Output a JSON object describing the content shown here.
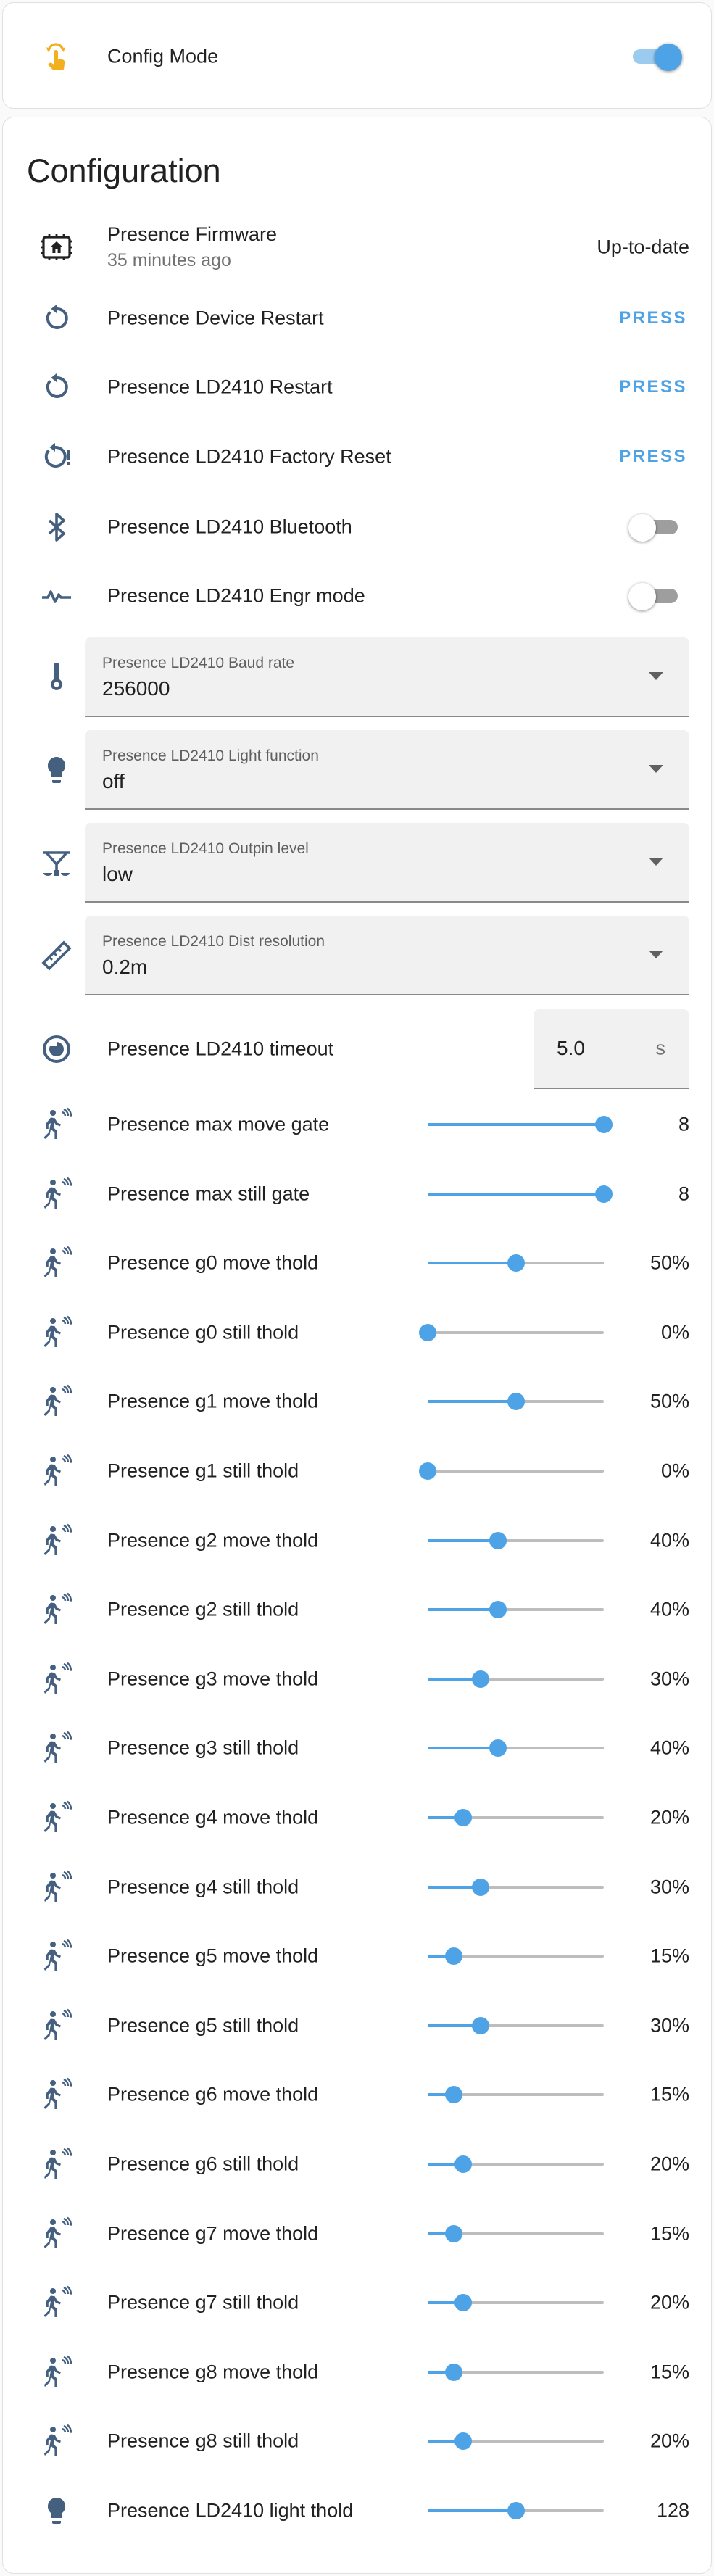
{
  "config_mode": {
    "label": "Config Mode",
    "on": true
  },
  "configuration": {
    "title": "Configuration",
    "firmware": {
      "label": "Presence Firmware",
      "time": "35 minutes ago",
      "status": "Up-to-date"
    },
    "buttons": [
      {
        "label": "Presence Device Restart",
        "action": "PRESS",
        "icon": "restart-icon"
      },
      {
        "label": "Presence LD2410 Restart",
        "action": "PRESS",
        "icon": "restart-icon"
      },
      {
        "label": "Presence LD2410 Factory Reset",
        "action": "PRESS",
        "icon": "factory-reset-icon"
      }
    ],
    "switches": [
      {
        "label": "Presence LD2410 Bluetooth",
        "on": false,
        "icon": "bluetooth-icon"
      },
      {
        "label": "Presence LD2410 Engr mode",
        "on": false,
        "icon": "pulse-icon"
      }
    ],
    "selects": [
      {
        "label": "Presence LD2410 Baud rate",
        "value": "256000",
        "icon": "thermometer-icon"
      },
      {
        "label": "Presence LD2410 Light function",
        "value": "off",
        "icon": "lightbulb-icon"
      },
      {
        "label": "Presence LD2410 Outpin level",
        "value": "low",
        "icon": "scale-icon"
      },
      {
        "label": "Presence LD2410 Dist resolution",
        "value": "0.2m",
        "icon": "ruler-icon"
      }
    ],
    "timeout": {
      "label": "Presence LD2410 timeout",
      "value": "5.0",
      "unit": "s"
    },
    "sliders": [
      {
        "label": "Presence max move gate",
        "value": "8",
        "fraction": 1.0,
        "icon": "motion-sensor-icon"
      },
      {
        "label": "Presence max still gate",
        "value": "8",
        "fraction": 1.0,
        "icon": "motion-sensor-icon"
      },
      {
        "label": "Presence g0 move thold",
        "value": "50%",
        "fraction": 0.5,
        "icon": "motion-sensor-icon"
      },
      {
        "label": "Presence g0 still thold",
        "value": "0%",
        "fraction": 0.0,
        "icon": "motion-sensor-icon"
      },
      {
        "label": "Presence g1 move thold",
        "value": "50%",
        "fraction": 0.5,
        "icon": "motion-sensor-icon"
      },
      {
        "label": "Presence g1 still thold",
        "value": "0%",
        "fraction": 0.0,
        "icon": "motion-sensor-icon"
      },
      {
        "label": "Presence g2 move thold",
        "value": "40%",
        "fraction": 0.4,
        "icon": "motion-sensor-icon"
      },
      {
        "label": "Presence g2 still thold",
        "value": "40%",
        "fraction": 0.4,
        "icon": "motion-sensor-icon"
      },
      {
        "label": "Presence g3 move thold",
        "value": "30%",
        "fraction": 0.3,
        "icon": "motion-sensor-icon"
      },
      {
        "label": "Presence g3 still thold",
        "value": "40%",
        "fraction": 0.4,
        "icon": "motion-sensor-icon"
      },
      {
        "label": "Presence g4 move thold",
        "value": "20%",
        "fraction": 0.2,
        "icon": "motion-sensor-icon"
      },
      {
        "label": "Presence g4 still thold",
        "value": "30%",
        "fraction": 0.3,
        "icon": "motion-sensor-icon"
      },
      {
        "label": "Presence g5 move thold",
        "value": "15%",
        "fraction": 0.15,
        "icon": "motion-sensor-icon"
      },
      {
        "label": "Presence g5 still thold",
        "value": "30%",
        "fraction": 0.3,
        "icon": "motion-sensor-icon"
      },
      {
        "label": "Presence g6 move thold",
        "value": "15%",
        "fraction": 0.15,
        "icon": "motion-sensor-icon"
      },
      {
        "label": "Presence g6 still thold",
        "value": "20%",
        "fraction": 0.2,
        "icon": "motion-sensor-icon"
      },
      {
        "label": "Presence g7 move thold",
        "value": "15%",
        "fraction": 0.15,
        "icon": "motion-sensor-icon"
      },
      {
        "label": "Presence g7 still thold",
        "value": "20%",
        "fraction": 0.2,
        "icon": "motion-sensor-icon"
      },
      {
        "label": "Presence g8 move thold",
        "value": "15%",
        "fraction": 0.15,
        "icon": "motion-sensor-icon"
      },
      {
        "label": "Presence g8 still thold",
        "value": "20%",
        "fraction": 0.2,
        "icon": "motion-sensor-icon"
      },
      {
        "label": "Presence LD2410 light thold",
        "value": "128",
        "fraction": 0.5,
        "icon": "lightbulb-icon"
      }
    ]
  },
  "colors": {
    "accent": "#4ea3e6",
    "config_icon": "#f2b01e",
    "icon_blue": "#45607f"
  }
}
